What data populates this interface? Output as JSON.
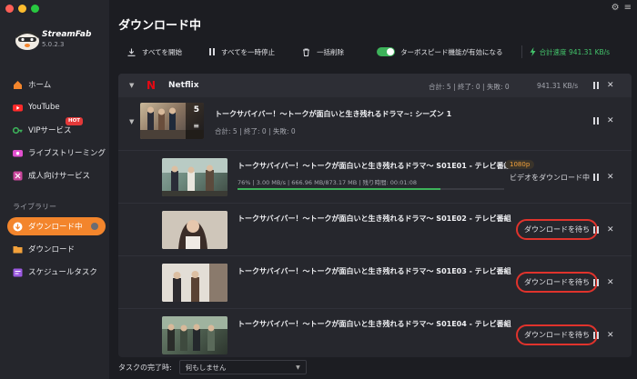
{
  "app": {
    "brand": "StreamFab",
    "version": "5.0.2.3"
  },
  "colors": {
    "accent": "#f3852c",
    "success": "#3db25a",
    "netflix": "#e50914",
    "highlight": "#e0332c"
  },
  "sidebar": {
    "items": [
      {
        "label": "ホーム",
        "icon": "home-icon"
      },
      {
        "label": "YouTube",
        "icon": "youtube-icon"
      },
      {
        "label": "VIPサービス",
        "icon": "vip-key-icon",
        "badge": "HOT"
      },
      {
        "label": "ライブストリーミング",
        "icon": "live-icon"
      },
      {
        "label": "成人向けサービス",
        "icon": "adult-icon"
      }
    ],
    "library_label": "ライブラリー",
    "library_items": [
      {
        "label": "ダウンロード中",
        "icon": "download-icon",
        "active": true
      },
      {
        "label": "ダウンロード",
        "icon": "folder-icon"
      },
      {
        "label": "スケジュールタスク",
        "icon": "schedule-icon"
      }
    ]
  },
  "header": {
    "title": "ダウンロード中"
  },
  "toolbar": {
    "start_all": "すべてを開始",
    "pause_all": "すべてを一時停止",
    "delete_all": "一括削除",
    "turbo_label": "ターボスピード機能が有効になる",
    "turbo_enabled": true,
    "total_speed": "合計速度 941.31 KB/s"
  },
  "service": {
    "name": "Netflix",
    "stats": "合計: 5  |  終了: 0  |  失敗: 0",
    "speed": "941.31 KB/s"
  },
  "season": {
    "title": "トークサバイバー！～トークが面白いと生き残れるドラマ~: シーズン 1",
    "stats": "合計: 5  |  終了: 0  |  失敗: 0",
    "count_badge": "5"
  },
  "episodes": [
    {
      "title": "トークサバイバー！～トークが面白いと生き残れるドラマ～ S01E01 - テレビ番組",
      "quality": "1080p",
      "progress_text": "76%  |  3.00 MB/s  |  666.96 MB/873.17 MB  |  残り時間: 00:01:08",
      "progress": 0.76,
      "status": "ビデオをダウンロード中"
    },
    {
      "title": "トークサバイバー！～トークが面白いと生き残れるドラマ～ S01E02 - テレビ番組",
      "status": "ダウンロードを待ち"
    },
    {
      "title": "トークサバイバー！～トークが面白いと生き残れるドラマ～ S01E03 - テレビ番組",
      "status": "ダウンロードを待ち"
    },
    {
      "title": "トークサバイバー！～トークが面白いと生き残れるドラマ～ S01E04 - テレビ番組",
      "status": "ダウンロードを待ち"
    }
  ],
  "footer": {
    "label": "タスクの完了時:",
    "select_value": "何もしません"
  }
}
